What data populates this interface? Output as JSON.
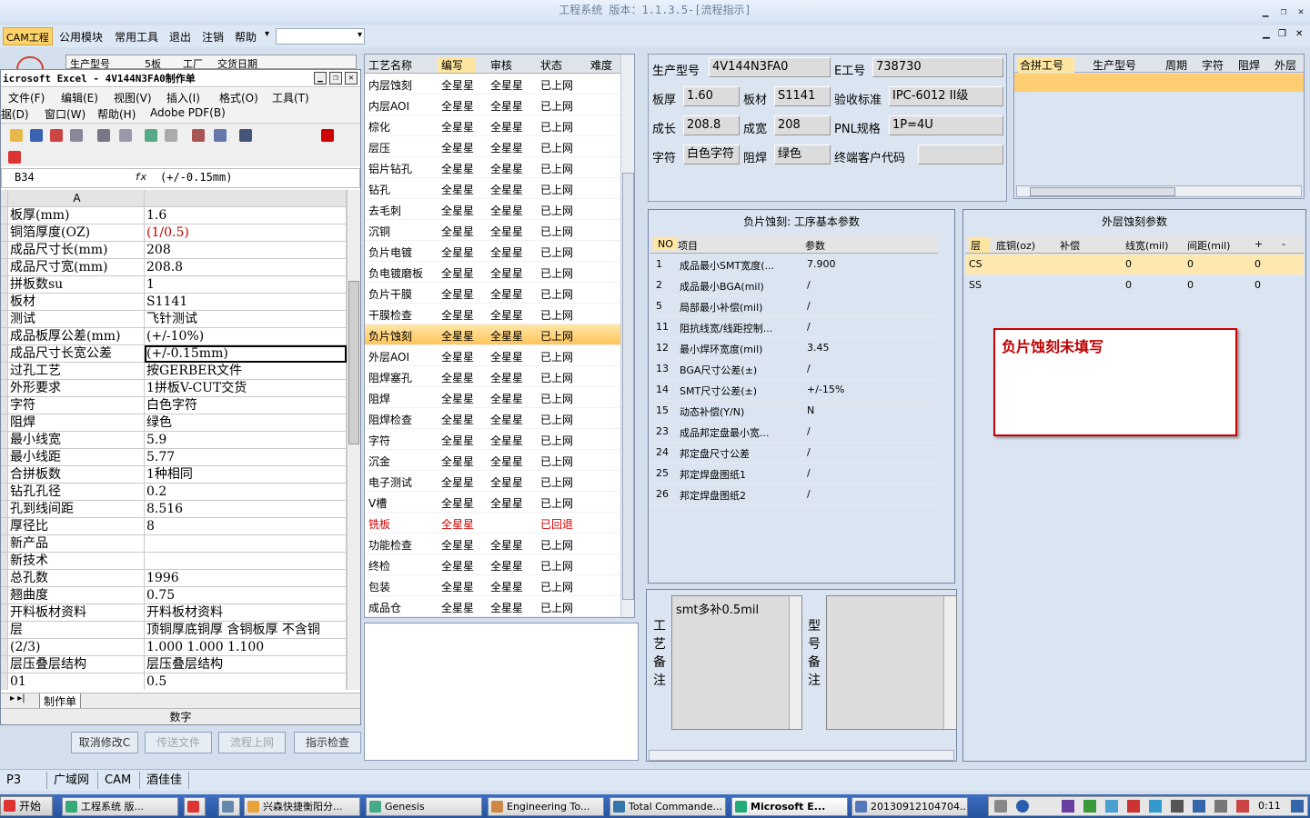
{
  "window": {
    "title": "工程系统  版本：1.1.3.5-[流程指示]",
    "minimize": "▁",
    "restore": "❐",
    "close": "✕"
  },
  "menu": {
    "items": [
      "CAM工程",
      "公用模块",
      "常用工具",
      "退出",
      "注销",
      "帮助"
    ],
    "help_arrow": "▾",
    "combo_arrow": "▾"
  },
  "excel": {
    "title": "icrosoft Excel - 4V144N3FA0制作单",
    "menu_row1": [
      "文件(F)",
      "编辑(E)",
      "视图(V)",
      "插入(I)",
      "格式(O)",
      "工具(T)"
    ],
    "menu_row2": [
      "据(D)",
      "窗口(W)",
      "帮助(H)",
      "Adobe PDF(B)"
    ],
    "cell_ref": "B34",
    "fx": "fx",
    "formula": "(+/-0.15mm)",
    "col_a": "A",
    "rows": [
      {
        "a": "板厚(mm)",
        "b": "1.6"
      },
      {
        "a": "铜箔厚度(OZ)",
        "b": " (1/0.5)",
        "red": true
      },
      {
        "a": "成品尺寸长(mm)",
        "b": "208"
      },
      {
        "a": "成品尺寸宽(mm)",
        "b": "208.8"
      },
      {
        "a": "拼板数su",
        "b": "1"
      },
      {
        "a": "板材",
        "b": "S1141"
      },
      {
        "a": "测试",
        "b": "飞针测试"
      },
      {
        "a": "成品板厚公差(mm)",
        "b": "(+/-10%)"
      },
      {
        "a": "成品尺寸长宽公差",
        "b": "(+/-0.15mm)"
      },
      {
        "a": "过孔工艺",
        "b": "按GERBER文件"
      },
      {
        "a": "外形要求",
        "b": "1拼板V-CUT交货"
      },
      {
        "a": "字符",
        "b": "白色字符"
      },
      {
        "a": "阻焊",
        "b": "绿色"
      },
      {
        "a": "最小线宽",
        "b": "5.9"
      },
      {
        "a": "最小线距",
        "b": "5.77"
      },
      {
        "a": "合拼板数",
        "b": "1种相同"
      },
      {
        "a": "钻孔孔径",
        "b": "0.2"
      },
      {
        "a": "孔到线间距",
        "b": "8.516"
      },
      {
        "a": "厚径比",
        "b": "8"
      },
      {
        "a": "新产品",
        "b": ""
      },
      {
        "a": "新技术",
        "b": ""
      },
      {
        "a": "总孔数",
        "b": "1996"
      },
      {
        "a": "翘曲度",
        "b": "0.75"
      },
      {
        "a": "开料板材资料",
        "b": "开料板材资料"
      },
      {
        "a": "层",
        "b": "顶铜厚底铜厚  含铜板厚  不含铜"
      },
      {
        "a": "(2/3)",
        "b": "1.000   1.000    1.100"
      },
      {
        "a": "层压叠层结构",
        "b": "层压叠层结构"
      },
      {
        "a": "01",
        "b": "0.5"
      }
    ],
    "sheet_tab": "制作单",
    "status": "数字",
    "bg_tabs": [
      "生产型号",
      "5板",
      "工厂",
      "交货日期"
    ]
  },
  "buttons": {
    "cancel": "取消修改C",
    "send": "传送文件",
    "flow": "流程上网",
    "check": "指示检查"
  },
  "process": {
    "headers": [
      "工艺名称",
      "编写",
      "审核",
      "状态",
      "难度"
    ],
    "rows": [
      [
        "内层蚀刻",
        "全星星",
        "全星星",
        "已上网"
      ],
      [
        "内层AOI",
        "全星星",
        "全星星",
        "已上网"
      ],
      [
        "棕化",
        "全星星",
        "全星星",
        "已上网"
      ],
      [
        "层压",
        "全星星",
        "全星星",
        "已上网"
      ],
      [
        "铝片钻孔",
        "全星星",
        "全星星",
        "已上网"
      ],
      [
        "钻孔",
        "全星星",
        "全星星",
        "已上网"
      ],
      [
        "去毛刺",
        "全星星",
        "全星星",
        "已上网"
      ],
      [
        "沉铜",
        "全星星",
        "全星星",
        "已上网"
      ],
      [
        "负片电镀",
        "全星星",
        "全星星",
        "已上网"
      ],
      [
        "负电镀磨板",
        "全星星",
        "全星星",
        "已上网"
      ],
      [
        "负片干膜",
        "全星星",
        "全星星",
        "已上网"
      ],
      [
        "干膜检查",
        "全星星",
        "全星星",
        "已上网"
      ],
      [
        "负片蚀刻",
        "全星星",
        "全星星",
        "已上网"
      ],
      [
        "外层AOI",
        "全星星",
        "全星星",
        "已上网"
      ],
      [
        "阻焊塞孔",
        "全星星",
        "全星星",
        "已上网"
      ],
      [
        "阻焊",
        "全星星",
        "全星星",
        "已上网"
      ],
      [
        "阻焊检查",
        "全星星",
        "全星星",
        "已上网"
      ],
      [
        "字符",
        "全星星",
        "全星星",
        "已上网"
      ],
      [
        "沉金",
        "全星星",
        "全星星",
        "已上网"
      ],
      [
        "电子测试",
        "全星星",
        "全星星",
        "已上网"
      ],
      [
        "V槽",
        "全星星",
        "全星星",
        "已上网"
      ],
      [
        "铣板",
        "全星星",
        "",
        "已回退"
      ],
      [
        "功能检查",
        "全星星",
        "全星星",
        "已上网"
      ],
      [
        "终检",
        "全星星",
        "全星星",
        "已上网"
      ],
      [
        "包装",
        "全星星",
        "全星星",
        "已上网"
      ],
      [
        "成品仓",
        "全星星",
        "全星星",
        "已上网"
      ]
    ],
    "selected_index": 12,
    "returned_index": 21
  },
  "info": {
    "model_label": "生产型号",
    "model": "4V144N3FA0",
    "e_label": "E工号",
    "e_no": "738730",
    "thick_label": "板厚",
    "thick": "1.60",
    "mat_label": "板材",
    "mat": "S1141",
    "std_label": "验收标准",
    "std": "IPC-6012 II级",
    "len_label": "成长",
    "len": "208.8",
    "wid_label": "成宽",
    "wid": "208",
    "pnl_label": "PNL规格",
    "pnl": "1P=4U",
    "char_label": "字符",
    "char": "白色字符",
    "mask_label": "阻焊",
    "mask": "绿色",
    "cust_label": "终端客户代码",
    "cust": ""
  },
  "merge_table": {
    "headers": [
      "合拼工号",
      "生产型号",
      "周期",
      "字符",
      "阻焊",
      "外层"
    ]
  },
  "etch_params": {
    "title": "负片蚀刻: 工序基本参数",
    "headers": [
      "NO",
      "项目",
      "参数"
    ],
    "rows": [
      [
        "1",
        "成品最小SMT宽度(...",
        "7.900"
      ],
      [
        "2",
        "成品最小BGA(mil)",
        "/"
      ],
      [
        "5",
        "局部最小补偿(mil)",
        "/"
      ],
      [
        "11",
        "阻抗线宽/线距控制...",
        "/"
      ],
      [
        "12",
        "最小焊环宽度(mil)",
        "3.45"
      ],
      [
        "13",
        "BGA尺寸公差(±)",
        "/"
      ],
      [
        "14",
        "SMT尺寸公差(±)",
        "+/-15%"
      ],
      [
        "15",
        "动态补偿(Y/N)",
        "N"
      ],
      [
        "23",
        "成品邦定盘最小宽...",
        "/"
      ],
      [
        "24",
        "邦定盘尺寸公差",
        "/"
      ],
      [
        "25",
        "邦定焊盘图纸1",
        "/"
      ],
      [
        "26",
        "邦定焊盘图纸2",
        "/"
      ]
    ]
  },
  "outer_etch": {
    "title": "外层蚀刻参数",
    "headers": [
      "层",
      "底铜(oz)",
      "补偿",
      "线宽(mil)",
      "间距(mil)",
      "+",
      "-"
    ],
    "rows": [
      [
        "CS",
        "",
        "",
        "0",
        "0",
        "0",
        ""
      ],
      [
        "SS",
        "",
        "",
        "0",
        "0",
        "0",
        ""
      ]
    ]
  },
  "alert": "负片蚀刻未填写",
  "notes": {
    "process_label": [
      "工",
      "艺",
      "备",
      "注"
    ],
    "process_text": "smt多补0.5mil",
    "model_label": [
      "型",
      "号",
      "备",
      "注"
    ],
    "model_text": ""
  },
  "statusbar": [
    "P3",
    "广域网",
    "CAM",
    "酒佳佳"
  ],
  "taskbar": {
    "start": "开始",
    "tasks": [
      "工程系统  版...",
      "",
      "",
      "兴森快捷衡阳分...",
      "Genesis",
      "Engineering To...",
      "Total Commande...",
      "Microsoft E...",
      "20130912104704..."
    ],
    "clock": "0:11"
  }
}
